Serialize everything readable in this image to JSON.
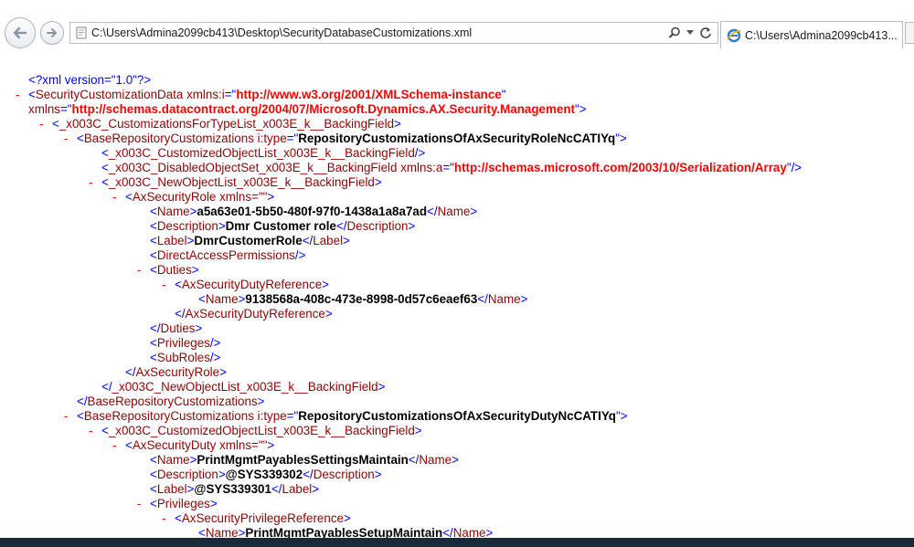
{
  "browser": {
    "address": "C:\\Users\\Admina2099cb413\\Desktop\\SecurityDatabaseCustomizations.xml",
    "tab_title": "C:\\Users\\Admina2099cb413...",
    "icons": [
      "back-arrow-icon",
      "forward-arrow-icon",
      "ie-page-icon",
      "search-icon",
      "dropdown-icon",
      "refresh-icon",
      "ie-tab-icon"
    ]
  },
  "xml": {
    "declaration": "<?xml version=\"1.0\"?>",
    "root_open": "SecurityCustomizationData",
    "ns_i_name": "xmlns:i",
    "ns_i_value": "http://www.w3.org/2001/XMLSchema-instance",
    "ns_name": "xmlns",
    "ns_value": "http://schemas.datacontract.org/2004/07/Microsoft.Dynamics.AX.Security.Management",
    "for_type_list": "_x003C_CustomizationsForTypeList_x003E_k__BackingField",
    "base_repo": "BaseRepositoryCustomizations",
    "itype_name": "i:type",
    "type_role": "RepositoryCustomizationsOfAxSecurityRoleNcCATIYq",
    "customized_list": "_x003C_CustomizedObjectList_x003E_k__BackingField",
    "disabled_set": "_x003C_DisabledObjectSet_x003E_k__BackingField",
    "ns_a_name": "xmlns:a",
    "ns_a_value": "http://schemas.microsoft.com/2003/10/Serialization/Array",
    "new_list": "_x003C_NewObjectList_x003E_k__BackingField",
    "ax_role": "AxSecurityRole",
    "xmlns_empty": "xmlns=\"\"",
    "name_tag": "Name",
    "role_name": "a5a63e01-5b50-480f-97f0-1438a1a8a7ad",
    "desc_tag": "Description",
    "role_desc": "Dmr Customer role",
    "label_tag": "Label",
    "role_label": "DmrCustomerRole",
    "direct_access": "DirectAccessPermissions",
    "duties_tag": "Duties",
    "duty_ref": "AxSecurityDutyReference",
    "duty_ref_name": "9138568a-408c-473e-8998-0d57c6eaef63",
    "privileges_tag": "Privileges",
    "subroles_tag": "SubRoles",
    "type_duty": "RepositoryCustomizationsOfAxSecurityDutyNcCATIYq",
    "ax_duty": "AxSecurityDuty",
    "duty_name": "PrintMgmtPayablesSettingsMaintain",
    "duty_desc": "@SYS339302",
    "duty_label": "@SYS339301",
    "priv_ref": "AxSecurityPrivilegeReference",
    "priv_ref_name": "PrintMgmtPayablesSetupMaintain"
  }
}
